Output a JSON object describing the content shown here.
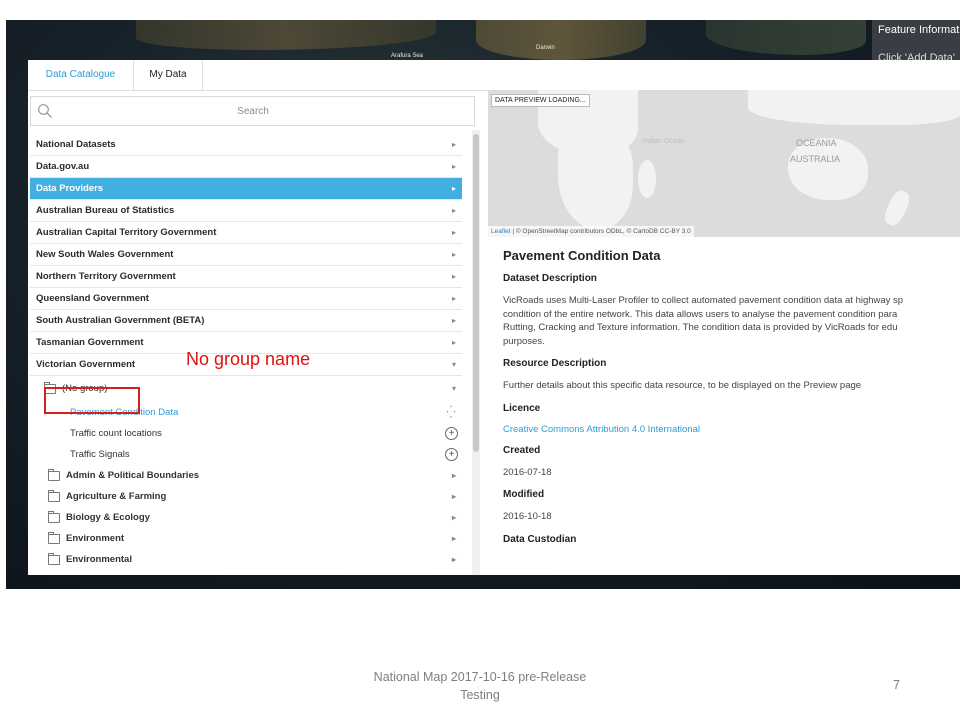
{
  "background_map": {
    "labels": [
      "Darwin",
      "Arafura Sea"
    ]
  },
  "feature_panel": {
    "title": "Feature Informat",
    "hint": "Click 'Add Data'"
  },
  "tabs": [
    {
      "label": "Data Catalogue",
      "active": true
    },
    {
      "label": "My Data",
      "active": false
    }
  ],
  "search": {
    "placeholder": "Search"
  },
  "catalogue": {
    "rows": [
      {
        "label": "National Datasets"
      },
      {
        "label": "Data.gov.au"
      },
      {
        "label": "Data Providers",
        "active": true
      },
      {
        "label": "Australian Bureau of Statistics"
      },
      {
        "label": "Australian Capital Territory Government"
      },
      {
        "label": "New South Wales Government"
      },
      {
        "label": "Northern Territory Government"
      },
      {
        "label": "Queensland Government"
      },
      {
        "label": "South Australian Government (BETA)"
      },
      {
        "label": "Tasmanian Government"
      },
      {
        "label": "Victorian Government",
        "expanded": true
      }
    ],
    "no_group": {
      "label": "(No group)"
    },
    "no_group_items": [
      {
        "label": "Pavement Condition Data",
        "status": "loading"
      },
      {
        "label": "Traffic count locations",
        "status": "add"
      },
      {
        "label": "Traffic Signals",
        "status": "add"
      }
    ],
    "groups": [
      {
        "label": "Admin & Political Boundaries"
      },
      {
        "label": "Agriculture & Farming"
      },
      {
        "label": "Biology & Ecology"
      },
      {
        "label": "Environment"
      },
      {
        "label": "Environmental"
      }
    ]
  },
  "annotation": {
    "text": "No group name",
    "color": "#e01010"
  },
  "preview": {
    "status": "DATA PREVIEW LOADING...",
    "ocean_label": "Indian Ocean",
    "region_label_1": "OCEANIA",
    "region_label_2": "AUSTRALIA",
    "attribution_link": "Leaflet",
    "attribution_text": "| © OpenStreetMap contributors ODbL, © CartoDB CC-BY 3.0"
  },
  "details": {
    "title": "Pavement Condition Data",
    "dataset_description_heading": "Dataset Description",
    "dataset_description_lines": [
      "VicRoads uses Multi-Laser Profiler to collect automated pavement condition data at highway sp",
      "condition of the entire network. This data allows users to analyse the pavement condition para",
      "Rutting, Cracking and Texture information. The condition data is provided by VicRoads for edu",
      "purposes."
    ],
    "resource_description_heading": "Resource Description",
    "resource_description": "Further details about this specific data resource, to be displayed on the Preview page",
    "licence_heading": "Licence",
    "licence_link": "Creative Commons Attribution 4.0 International",
    "created_heading": "Created",
    "created": "2016-07-18",
    "modified_heading": "Modified",
    "modified": "2016-10-18",
    "custodian_heading": "Data Custodian"
  },
  "slide": {
    "footer_line1": "National Map 2017-10-16 pre-Release",
    "footer_line2": "Testing",
    "page_number": "7"
  },
  "colors": {
    "accent": "#2a9fd6",
    "active_row": "#41b0e0",
    "annotation_red": "#d42020"
  }
}
